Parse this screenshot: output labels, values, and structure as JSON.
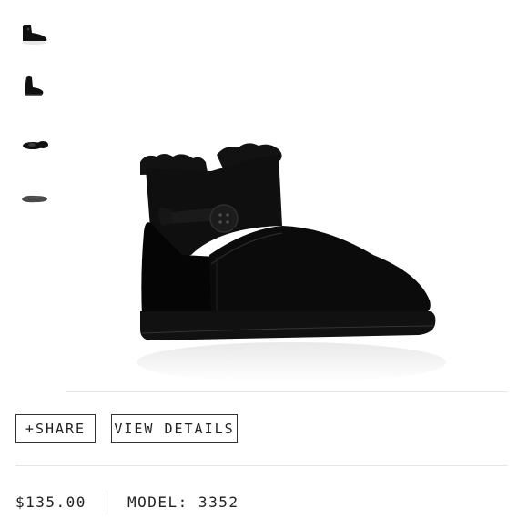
{
  "gallery": {
    "thumbnails": [
      {
        "icon": "boot-side-thumbnail-icon",
        "selected": true
      },
      {
        "icon": "boot-front-thumbnail-icon",
        "selected": false
      },
      {
        "icon": "boot-top-thumbnail-icon",
        "selected": false
      },
      {
        "icon": "boot-sole-thumbnail-icon",
        "selected": false
      }
    ],
    "main_image_icon": "black-button-boot-icon"
  },
  "actions": {
    "share_icon": "+",
    "share_label": "SHARE",
    "details_label": "VIEW DETAILS"
  },
  "product": {
    "price": "$135.00",
    "model": "MODEL: 3352"
  },
  "colors": {
    "boot": "#0d0d0d",
    "border": "#333333",
    "divider": "#e6e6e6"
  }
}
